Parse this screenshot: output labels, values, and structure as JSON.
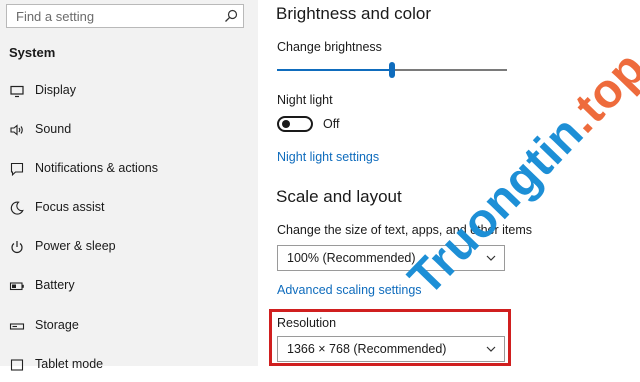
{
  "colors": {
    "accent": "#0f6cbd",
    "highlight_border": "#d01f1f",
    "sidebar_bg": "#f2f2f2"
  },
  "sidebar": {
    "search_placeholder": "Find a setting",
    "search_icon": "search-icon",
    "section_title": "System",
    "items": [
      {
        "label": "Display",
        "icon": "monitor-icon"
      },
      {
        "label": "Sound",
        "icon": "speaker-icon"
      },
      {
        "label": "Notifications & actions",
        "icon": "notification-icon"
      },
      {
        "label": "Focus assist",
        "icon": "moon-icon"
      },
      {
        "label": "Power & sleep",
        "icon": "power-icon"
      },
      {
        "label": "Battery",
        "icon": "battery-icon"
      },
      {
        "label": "Storage",
        "icon": "storage-icon"
      },
      {
        "label": "Tablet mode",
        "icon": "tablet-icon"
      }
    ]
  },
  "main": {
    "brightness": {
      "heading": "Brightness and color",
      "slider_label": "Change brightness",
      "brightness_fraction": 0.5
    },
    "night_light": {
      "label": "Night light",
      "toggle_state": "Off",
      "settings_link": "Night light settings"
    },
    "scale": {
      "heading": "Scale and layout",
      "size_label": "Change the size of text, apps, and other items",
      "size_value": "100% (Recommended)",
      "advanced_link": "Advanced scaling settings"
    },
    "resolution": {
      "label": "Resolution",
      "value": "1366 × 768 (Recommended)"
    }
  },
  "watermark": {
    "part1": "Truongtin",
    "part2": ".top"
  }
}
